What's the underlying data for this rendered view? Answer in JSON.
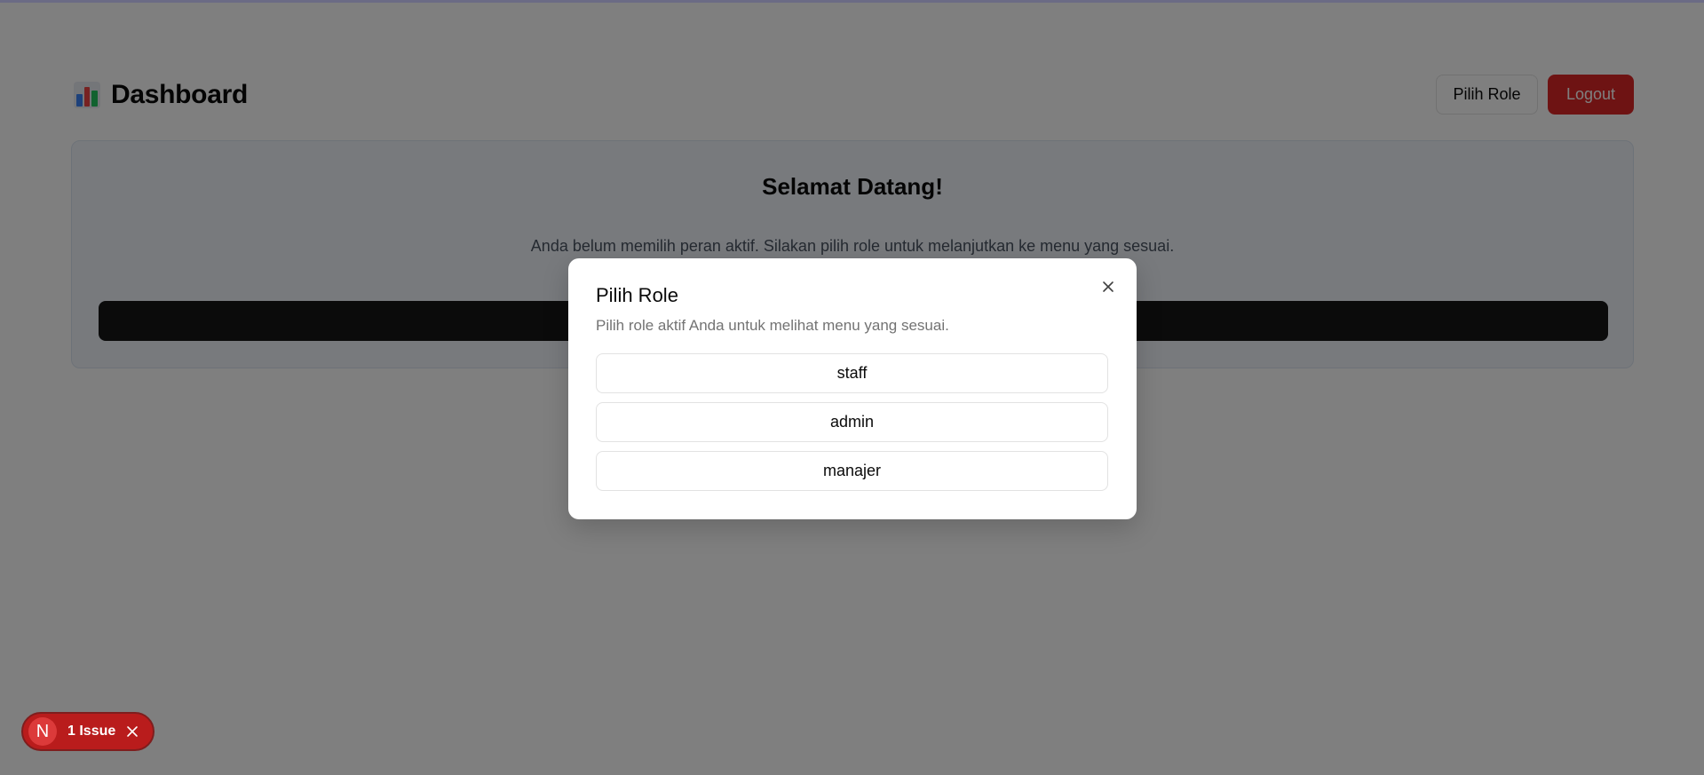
{
  "header": {
    "title": "Dashboard",
    "role_button_label": "Pilih Role",
    "logout_button_label": "Logout"
  },
  "welcome_card": {
    "title": "Selamat Datang!",
    "description": "Anda belum memilih peran aktif. Silakan pilih role untuk melanjutkan ke menu yang sesuai."
  },
  "role_dialog": {
    "title": "Pilih Role",
    "description": "Pilih role aktif Anda untuk melihat menu yang sesuai.",
    "roles": [
      "staff",
      "admin",
      "manajer"
    ]
  },
  "dev_indicator": {
    "logo_letter": "N",
    "issue_label": "1 Issue"
  },
  "colors": {
    "danger": "#dc2626",
    "overlay": "rgba(0,0,0,0.5)",
    "primary_button": "#171717"
  },
  "icons": [
    "bar-chart-icon",
    "close-icon"
  ]
}
